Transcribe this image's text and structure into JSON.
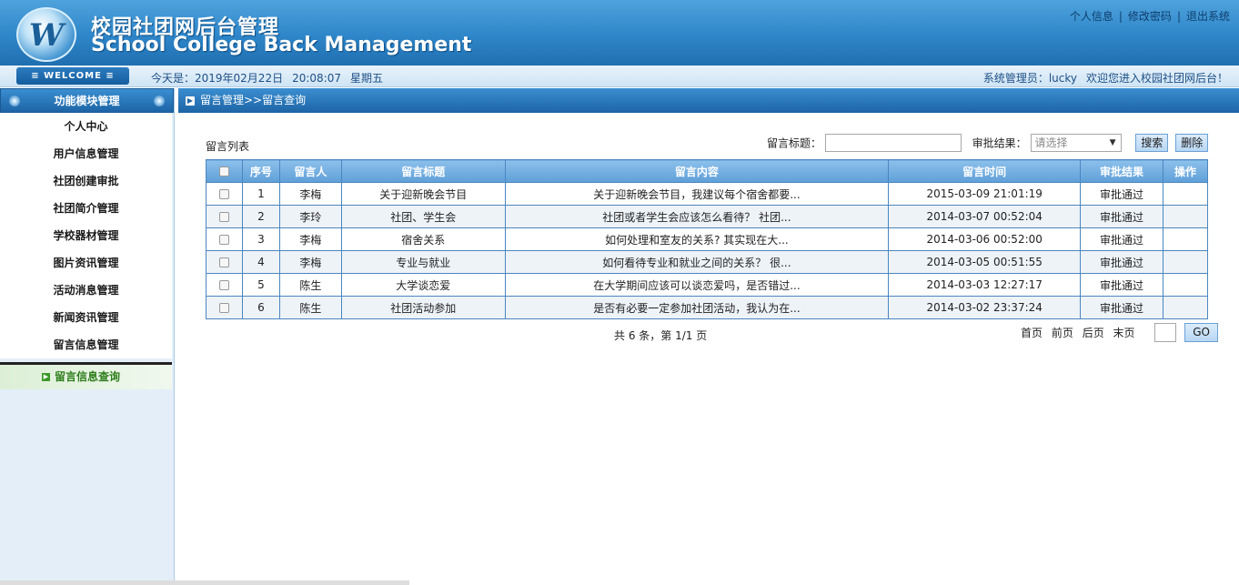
{
  "header": {
    "title_cn": "校园社团网后台管理",
    "title_en": "School College Back Management",
    "logo_letter": "W",
    "links": [
      "个人信息",
      "修改密码",
      "退出系统"
    ]
  },
  "infobar": {
    "welcome": "≡ WELCOME ≡",
    "date_label": "今天是：2019年02月22日",
    "time": "20:08:07",
    "weekday": "星期五",
    "admin": "系统管理员：lucky",
    "greeting": "欢迎您进入校园社团网后台！"
  },
  "sidebar": {
    "title": "功能模块管理",
    "items": [
      "个人中心",
      "用户信息管理",
      "社团创建审批",
      "社团简介管理",
      "学校器材管理",
      "图片资讯管理",
      "活动消息管理",
      "新闻资讯管理",
      "留言信息管理"
    ],
    "active_item": "留言信息查询"
  },
  "breadcrumb": "留言管理>>留言查询",
  "list": {
    "title": "留言列表",
    "search_title_label": "留言标题：",
    "search_title_value": "",
    "result_label": "审批结果：",
    "result_select": "请选择",
    "search_button": "搜索",
    "delete_button": "删除",
    "columns": [
      "",
      "序号",
      "留言人",
      "留言标题",
      "留言内容",
      "留言时间",
      "审批结果",
      "操作"
    ],
    "rows": [
      {
        "no": "1",
        "author": "李梅",
        "title": "关于迎新晚会节目",
        "content": "关于迎新晚会节目，我建议每个宿舍都要...",
        "time": "2015-03-09 21:01:19",
        "result": "审批通过",
        "op": ""
      },
      {
        "no": "2",
        "author": "李玲",
        "title": "社团、学生会",
        "content": "社团或者学生会应该怎么看待？ 社团...",
        "time": "2014-03-07 00:52:04",
        "result": "审批通过",
        "op": ""
      },
      {
        "no": "3",
        "author": "李梅",
        "title": "宿舍关系",
        "content": "如何处理和室友的关系? 其实现在大...",
        "time": "2014-03-06 00:52:00",
        "result": "审批通过",
        "op": ""
      },
      {
        "no": "4",
        "author": "李梅",
        "title": "专业与就业",
        "content": "如何看待专业和就业之间的关系？ 很...",
        "time": "2014-03-05 00:51:55",
        "result": "审批通过",
        "op": ""
      },
      {
        "no": "5",
        "author": "陈生",
        "title": "大学谈恋爱",
        "content": "在大学期间应该可以谈恋爱吗，是否错过...",
        "time": "2014-03-03 12:27:17",
        "result": "审批通过",
        "op": ""
      },
      {
        "no": "6",
        "author": "陈生",
        "title": "社团活动参加",
        "content": "是否有必要一定参加社团活动，我认为在...",
        "time": "2014-03-02 23:37:24",
        "result": "审批通过",
        "op": ""
      }
    ]
  },
  "pager": {
    "info": "共 6 条，第 1/1 页",
    "first": "首页",
    "prev": "前页",
    "next": "后页",
    "last": "末页",
    "page_value": "",
    "go": "GO"
  }
}
